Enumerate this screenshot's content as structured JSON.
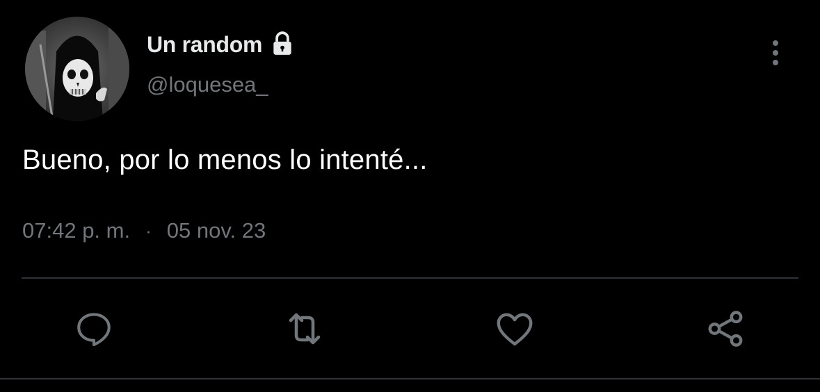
{
  "author": {
    "display_name": "Un random",
    "handle": "@loquesea_",
    "verified_badge_icon": "lock-icon",
    "avatar_icon": "grim-reaper-avatar"
  },
  "tweet": {
    "text": "Bueno, por lo menos lo intenté...",
    "time": "07:42 p. m.",
    "separator": "·",
    "date": "05 nov. 23"
  },
  "actions": [
    {
      "name": "reply",
      "icon": "reply-icon"
    },
    {
      "name": "retweet",
      "icon": "retweet-icon"
    },
    {
      "name": "like",
      "icon": "heart-icon"
    },
    {
      "name": "share",
      "icon": "share-icon"
    }
  ],
  "colors": {
    "background": "#000000",
    "primary_text": "#e7e9ea",
    "secondary_text": "#71767b",
    "icon": "#71767b",
    "divider": "#2f3336"
  }
}
